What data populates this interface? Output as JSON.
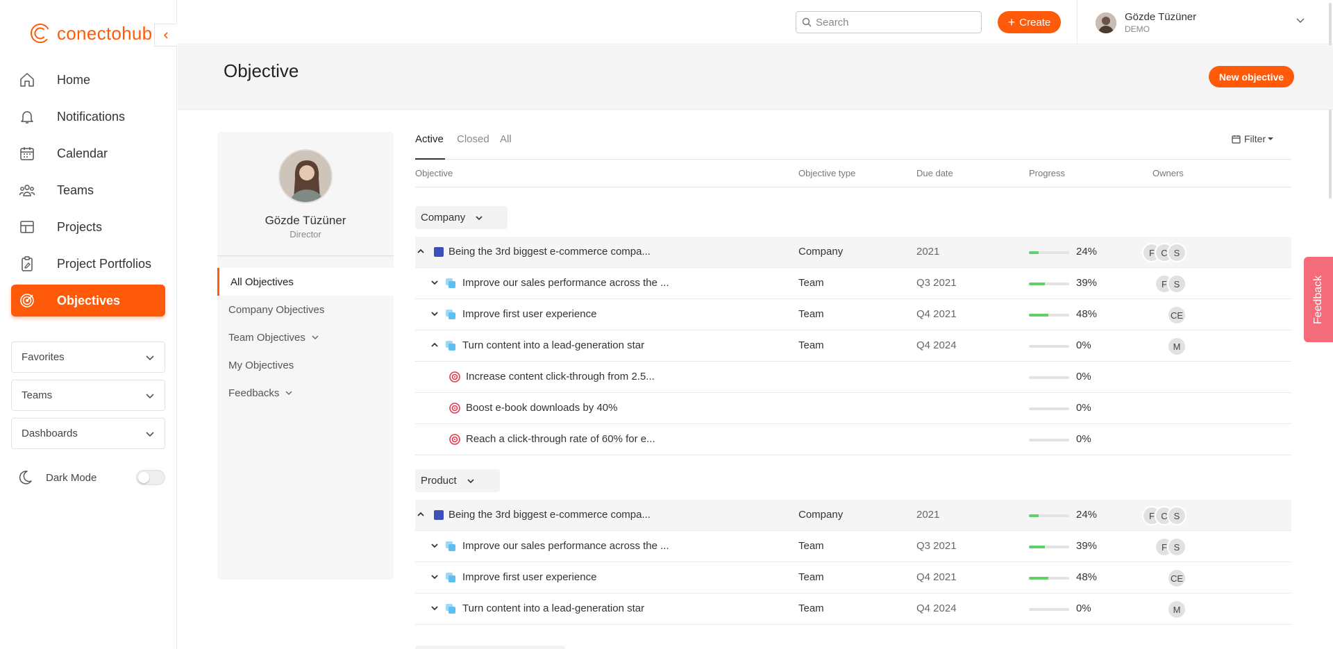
{
  "brand": {
    "name": "conectohub",
    "accent": "#ff5a0a"
  },
  "sidebar": {
    "items": [
      {
        "label": "Home",
        "icon": "home-icon"
      },
      {
        "label": "Notifications",
        "icon": "bell-icon"
      },
      {
        "label": "Calendar",
        "icon": "calendar-icon"
      },
      {
        "label": "Teams",
        "icon": "team-icon"
      },
      {
        "label": "Projects",
        "icon": "grid-icon"
      },
      {
        "label": "Project Portfolios",
        "icon": "clipboard-icon"
      },
      {
        "label": "Objectives",
        "icon": "target-icon",
        "active": true
      }
    ],
    "dropdowns": [
      "Favorites",
      "Teams",
      "Dashboards"
    ],
    "dark_mode_label": "Dark Mode",
    "dark_mode_on": false
  },
  "header": {
    "search_placeholder": "Search",
    "create_label": "Create",
    "user_name": "Gözde Tüzüner",
    "user_org": "DEMO"
  },
  "page": {
    "title": "Objective",
    "new_objective_label": "New objective"
  },
  "profile": {
    "name": "Gözde Tüzüner",
    "role": "Director",
    "menu": [
      {
        "label": "All Objectives",
        "active": true
      },
      {
        "label": "Company Objectives"
      },
      {
        "label": "Team Objectives",
        "has_chevron": true
      },
      {
        "label": "My Objectives"
      },
      {
        "label": "Feedbacks",
        "has_chevron": true
      }
    ]
  },
  "main": {
    "tabs": [
      "Active",
      "Closed",
      "All"
    ],
    "active_tab": "Active",
    "filter_label": "Filter",
    "columns": [
      "Objective",
      "Objective type",
      "Due date",
      "Progress",
      "Owners"
    ],
    "groups": [
      {
        "label": "Company",
        "rows": [
          {
            "level": 0,
            "expanded": true,
            "kind": "company",
            "name": "Being the 3rd biggest e-commerce compa...",
            "type": "Company",
            "due": "2021",
            "progress": 24,
            "pct": "24%",
            "owners": [
              "F",
              "C",
              "S"
            ]
          },
          {
            "level": 1,
            "expanded": false,
            "kind": "team",
            "name": "Improve our sales performance across the ...",
            "type": "Team",
            "due": "Q3 2021",
            "progress": 39,
            "pct": "39%",
            "owners": [
              "F",
              "S"
            ]
          },
          {
            "level": 1,
            "expanded": false,
            "kind": "team",
            "name": "Improve first user experience",
            "type": "Team",
            "due": "Q4 2021",
            "progress": 48,
            "pct": "48%",
            "owners": [
              "CE"
            ]
          },
          {
            "level": 1,
            "expanded": true,
            "kind": "team",
            "name": "Turn content into a lead-generation star",
            "type": "Team",
            "due": "Q4 2024",
            "progress": 0,
            "pct": "0%",
            "owners": [
              "M"
            ]
          },
          {
            "level": 2,
            "kind": "key-result",
            "name": "Increase content click-through from 2.5...",
            "type": "",
            "due": "",
            "progress": 0,
            "pct": "0%",
            "owners": []
          },
          {
            "level": 2,
            "kind": "key-result",
            "name": "Boost e-book downloads by 40%",
            "type": "",
            "due": "",
            "progress": 0,
            "pct": "0%",
            "owners": []
          },
          {
            "level": 2,
            "kind": "key-result",
            "name": "Reach a click-through rate of 60% for e...",
            "type": "",
            "due": "",
            "progress": 0,
            "pct": "0%",
            "owners": []
          }
        ]
      },
      {
        "label": "Product",
        "rows": [
          {
            "level": 0,
            "expanded": true,
            "kind": "company",
            "name": "Being the 3rd biggest e-commerce compa...",
            "type": "Company",
            "due": "2021",
            "progress": 24,
            "pct": "24%",
            "owners": [
              "F",
              "C",
              "S"
            ]
          },
          {
            "level": 1,
            "expanded": false,
            "kind": "team",
            "name": "Improve our sales performance across the ...",
            "type": "Team",
            "due": "Q3 2021",
            "progress": 39,
            "pct": "39%",
            "owners": [
              "F",
              "S"
            ]
          },
          {
            "level": 1,
            "expanded": false,
            "kind": "team",
            "name": "Improve first user experience",
            "type": "Team",
            "due": "Q4 2021",
            "progress": 48,
            "pct": "48%",
            "owners": [
              "CE"
            ]
          },
          {
            "level": 1,
            "expanded": false,
            "kind": "team",
            "name": "Turn content into a lead-generation star",
            "type": "Team",
            "due": "Q4 2024",
            "progress": 0,
            "pct": "0%",
            "owners": [
              "M"
            ]
          }
        ]
      }
    ]
  },
  "feedback_label": "Feedback"
}
